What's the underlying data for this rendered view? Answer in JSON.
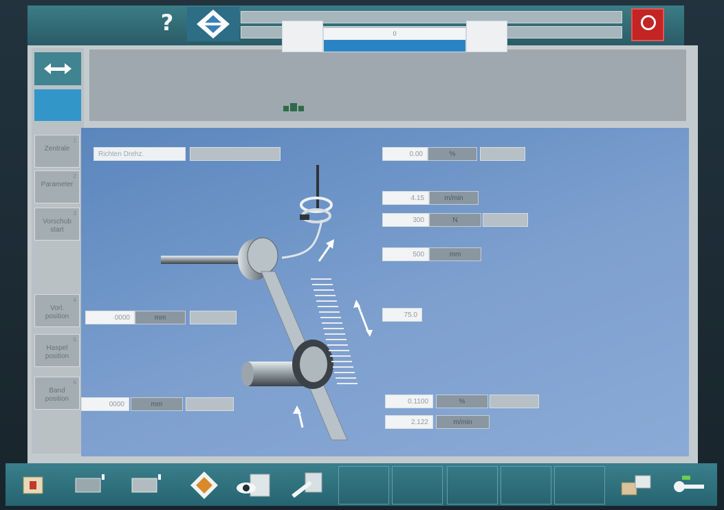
{
  "topbar": {
    "help_icon": "question-mark-icon",
    "nav_icon": "diamond-navigation-icon",
    "message_line_1": "",
    "message_line_2": "",
    "estop_icon": "power-stop-icon"
  },
  "sidebar": {
    "items": [
      {
        "label": "Zentrale",
        "num": "1"
      },
      {
        "label": "Parameter",
        "num": "2"
      },
      {
        "label": "Vorschub\nstart",
        "num": "3"
      },
      {
        "label": "Vorl.\nposition",
        "num": "4"
      },
      {
        "label": "Haspel\nposition",
        "num": "5"
      },
      {
        "label": "Band\nposition",
        "num": "6"
      }
    ]
  },
  "header": {
    "bar_value": "0",
    "bar_fill": 1.0
  },
  "process": {
    "top_left_label": "Richten Drehz.",
    "top_value": "0.00",
    "top_unit": "%",
    "speed_value": "4.15",
    "speed_unit": "m/min",
    "tension_value": "300",
    "tension_unit": "N",
    "length_value": "500",
    "length_unit": "mm",
    "stroke_value": "75.0",
    "left_mid_value": "0000",
    "left_mid_unit": "mm",
    "left_bottom_value": "0000",
    "left_bottom_unit": "mm",
    "bottom_value": "0.1100",
    "bottom_unit": "%",
    "bottom_speed_value": "2.122",
    "bottom_speed_unit": "m/min"
  },
  "bottom": {
    "icons": [
      "stop-run-icon",
      "machine-1-icon",
      "machine-2-icon",
      "diamond-settings-icon",
      "view-monitor-icon",
      "tool-icon"
    ],
    "right_icons": [
      "network-icon",
      "key-icon"
    ]
  },
  "colors": {
    "accent": "#3a7f8b",
    "work_area": "#6f94c7",
    "estop": "#c32424",
    "bar_fill": "#2a84c4"
  }
}
